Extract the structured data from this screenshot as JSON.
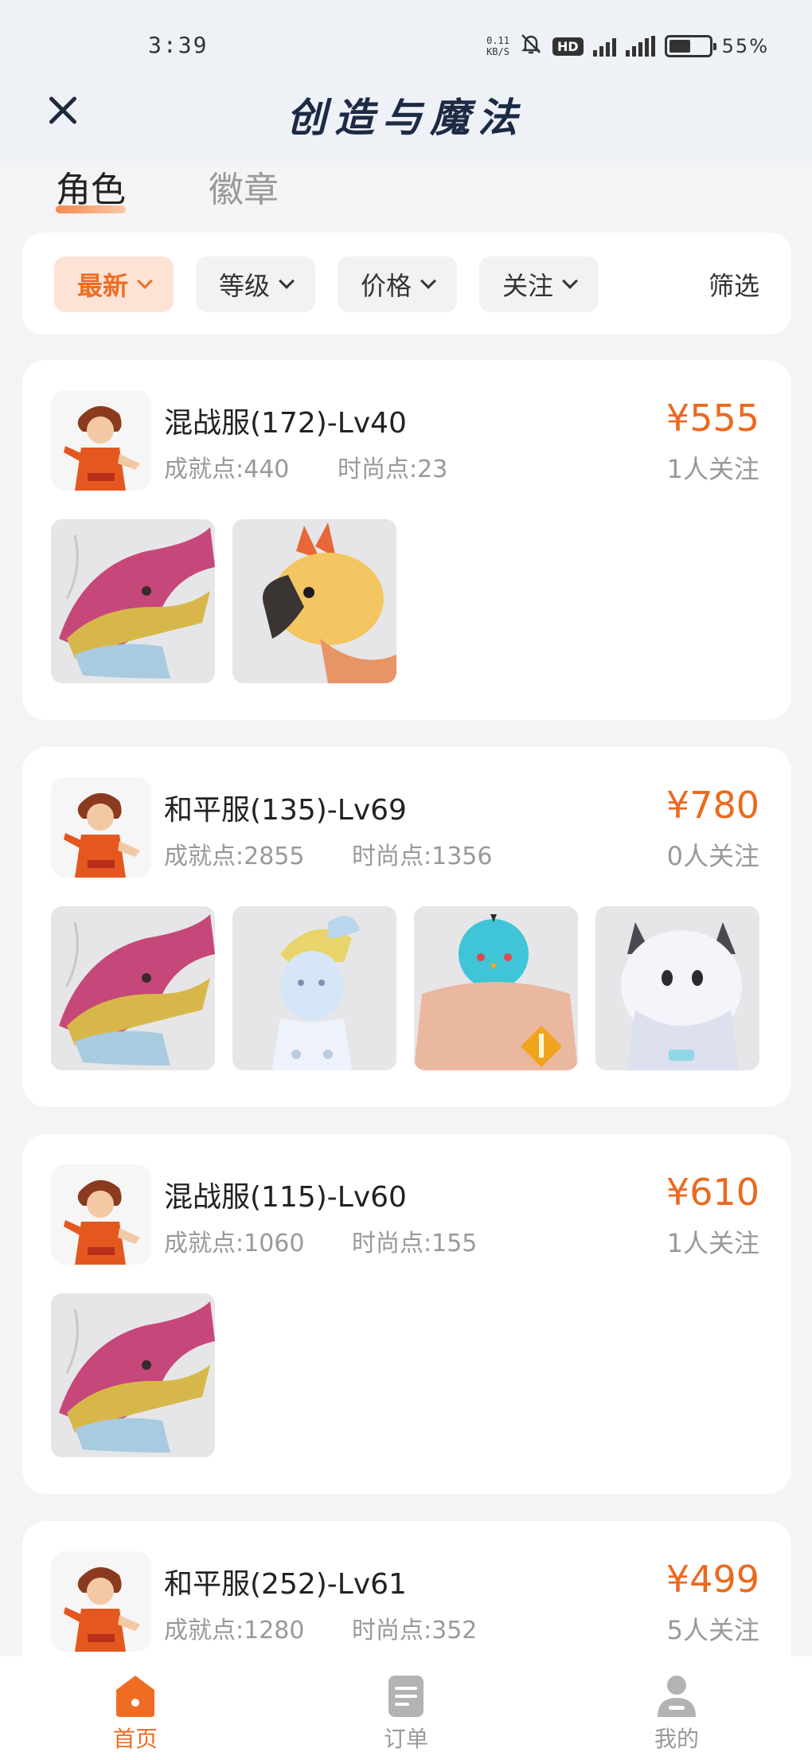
{
  "status": {
    "time": "3:39",
    "net_speed_value": "0.11",
    "net_speed_unit": "KB/S",
    "hd": "HD",
    "battery": "55%",
    "battery_level": 0.55
  },
  "header": {
    "title": "创造与魔法",
    "close_icon": "close-icon"
  },
  "tabs": [
    {
      "label": "角色",
      "active": true
    },
    {
      "label": "徽章",
      "active": false
    }
  ],
  "filters": {
    "chips": [
      {
        "label": "最新",
        "active": true
      },
      {
        "label": "等级",
        "active": false
      },
      {
        "label": "价格",
        "active": false
      },
      {
        "label": "关注",
        "active": false
      }
    ],
    "screen_label": "筛选"
  },
  "listings": [
    {
      "name": "混战服(172)-Lv40",
      "achievement": "成就点:440",
      "fashion": "时尚点:23",
      "price": "¥555",
      "followers": "1人关注",
      "items": [
        "dragon",
        "phoenix"
      ]
    },
    {
      "name": "和平服(135)-Lv69",
      "achievement": "成就点:2855",
      "fashion": "时尚点:1356",
      "price": "¥780",
      "followers": "0人关注",
      "items": [
        "dragon",
        "fairy",
        "blue-bird",
        "robot-cow"
      ]
    },
    {
      "name": "混战服(115)-Lv60",
      "achievement": "成就点:1060",
      "fashion": "时尚点:155",
      "price": "¥610",
      "followers": "1人关注",
      "items": [
        "dragon"
      ]
    },
    {
      "name": "和平服(252)-Lv61",
      "achievement": "成就点:1280",
      "fashion": "时尚点:352",
      "price": "¥499",
      "followers": "5人关注",
      "items": []
    }
  ],
  "bottom_nav": [
    {
      "label": "首页",
      "icon": "home-icon",
      "active": true
    },
    {
      "label": "订单",
      "icon": "clipboard-icon",
      "active": false
    },
    {
      "label": "我的",
      "icon": "user-icon",
      "active": false
    }
  ],
  "colors": {
    "accent": "#ef6d23",
    "price": "#ea6a1f",
    "header_bg": "#eef1f6",
    "page_bg": "#f4f4f6"
  }
}
